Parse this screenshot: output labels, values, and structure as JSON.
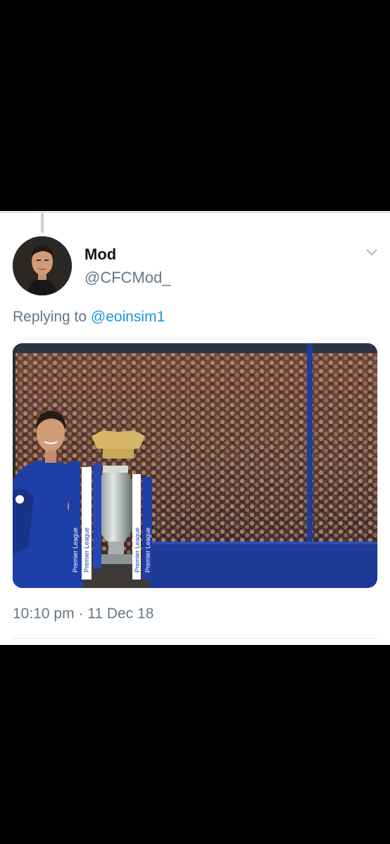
{
  "tweet": {
    "display_name": "Mod",
    "handle": "@CFCMod_",
    "replying_prefix": "Replying to",
    "replying_mention": "@eoinsim1",
    "timestamp": "10:10 pm · 11 Dec 18"
  },
  "media": {
    "trophy_ribbon_text": "Premier League"
  },
  "colors": {
    "text_primary": "#14171a",
    "text_secondary": "#657786",
    "link": "#1b95e0",
    "kit_blue": "#1e3fa8"
  }
}
